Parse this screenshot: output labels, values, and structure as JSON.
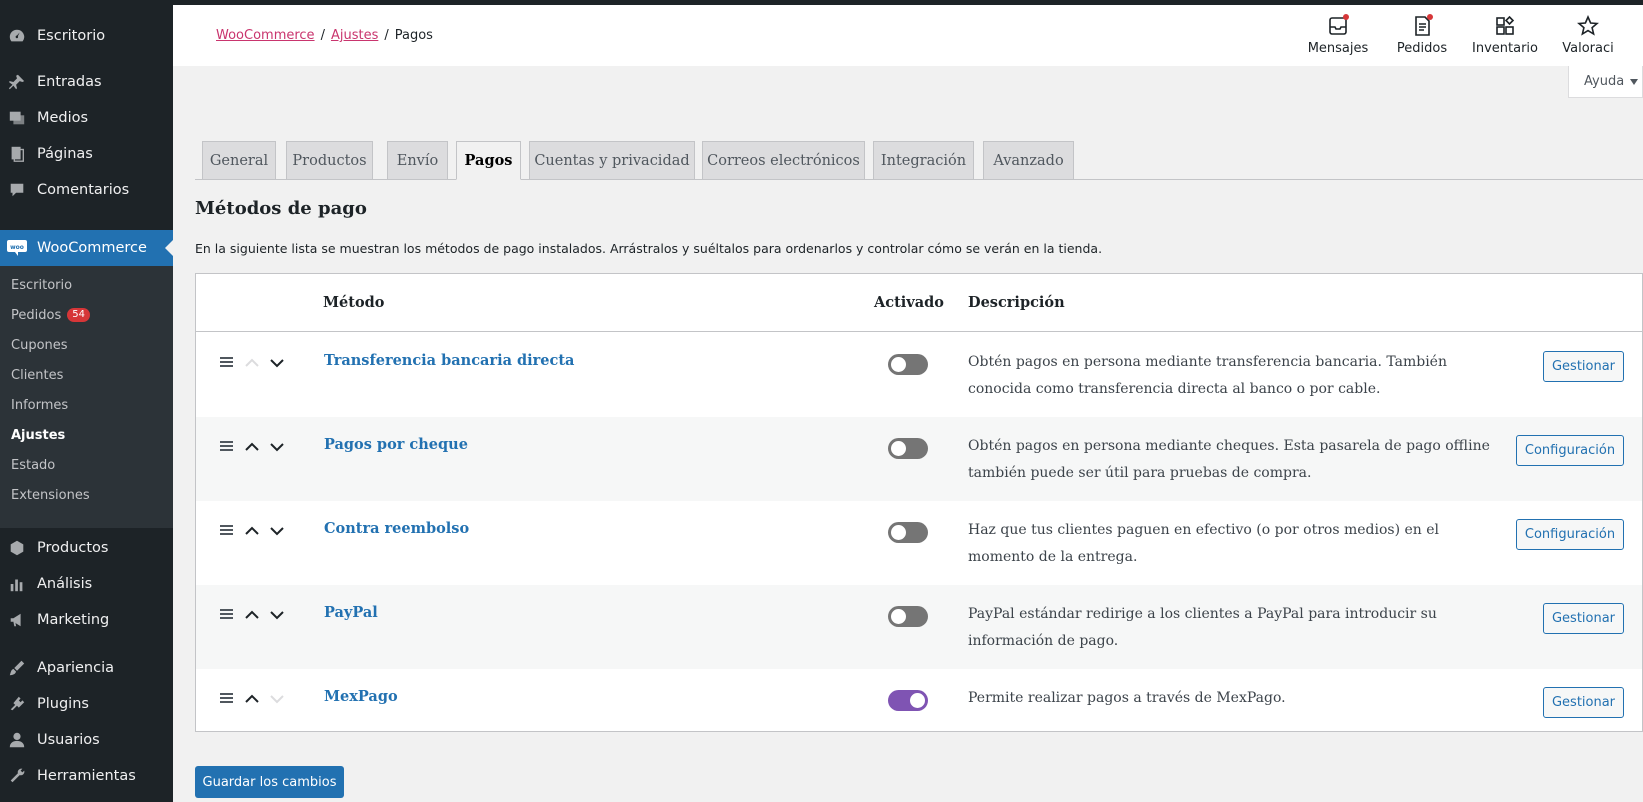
{
  "breadcrumb": {
    "root": "WooCommerce",
    "parent": "Ajustes",
    "current": "Pagos",
    "separator": "/"
  },
  "header_buttons": [
    {
      "label": "Mensajes",
      "icon": "inbox-icon",
      "has_dot": true
    },
    {
      "label": "Pedidos",
      "icon": "orders-icon",
      "has_dot": true
    },
    {
      "label": "Inventario",
      "icon": "inventory-icon",
      "has_dot": false
    },
    {
      "label": "Valoraci",
      "icon": "star-icon",
      "has_dot": false
    }
  ],
  "help_label": "Ayuda",
  "sidebar": {
    "items": [
      {
        "label": "Escritorio",
        "icon": "dashboard-icon"
      },
      {
        "label": "Entradas",
        "icon": "pin-icon"
      },
      {
        "label": "Medios",
        "icon": "media-icon"
      },
      {
        "label": "Páginas",
        "icon": "pages-icon"
      },
      {
        "label": "Comentarios",
        "icon": "comments-icon"
      },
      {
        "label": "WooCommerce",
        "icon": "woo-icon"
      },
      {
        "label": "Productos",
        "icon": "products-icon"
      },
      {
        "label": "Análisis",
        "icon": "analytics-icon"
      },
      {
        "label": "Marketing",
        "icon": "marketing-icon"
      },
      {
        "label": "Apariencia",
        "icon": "appearance-icon"
      },
      {
        "label": "Plugins",
        "icon": "plugins-icon"
      },
      {
        "label": "Usuarios",
        "icon": "users-icon"
      },
      {
        "label": "Herramientas",
        "icon": "tools-icon"
      }
    ],
    "submenu": [
      {
        "label": "Escritorio"
      },
      {
        "label": "Pedidos",
        "badge": "54"
      },
      {
        "label": "Cupones"
      },
      {
        "label": "Clientes"
      },
      {
        "label": "Informes"
      },
      {
        "label": "Ajustes"
      },
      {
        "label": "Estado"
      },
      {
        "label": "Extensiones"
      }
    ]
  },
  "tabs": [
    "General",
    "Productos",
    "Envío",
    "Pagos",
    "Cuentas y privacidad",
    "Correos electrónicos",
    "Integración",
    "Avanzado"
  ],
  "active_tab": "Pagos",
  "section": {
    "title": "Métodos de pago",
    "intro": "En la siguiente lista se muestran los métodos de pago instalados. Arrástralos y suéltalos para ordenarlos y controlar cómo se verán en la tienda."
  },
  "table": {
    "headers": {
      "method": "Método",
      "enabled": "Activado",
      "description": "Descripción"
    },
    "rows": [
      {
        "name": "Transferencia bancaria directa",
        "enabled": false,
        "description": "Obtén pagos en persona mediante transferencia bancaria. También conocida como transferencia directa al banco o por cable.",
        "action": "Gestionar"
      },
      {
        "name": "Pagos por cheque",
        "enabled": false,
        "description": "Obtén pagos en persona mediante cheques. Esta pasarela de pago offline también puede ser útil para pruebas de compra.",
        "action": "Configuración"
      },
      {
        "name": "Contra reembolso",
        "enabled": false,
        "description": "Haz que tus clientes paguen en efectivo (o por otros medios) en el momento de la entrega.",
        "action": "Configuración"
      },
      {
        "name": "PayPal",
        "enabled": false,
        "description": "PayPal estándar redirige a los clientes a PayPal para introducir su información de pago.",
        "action": "Gestionar"
      },
      {
        "name": "MexPago",
        "enabled": true,
        "description": "Permite realizar pagos a través de MexPago.",
        "action": "Gestionar"
      }
    ]
  },
  "save_label": "Guardar los cambios",
  "colors": {
    "sidebar": "#1d2327",
    "accent": "#2271b1",
    "toggle_on": "#7f54b3",
    "link_pink": "#c9356e",
    "badge": "#d63638"
  }
}
